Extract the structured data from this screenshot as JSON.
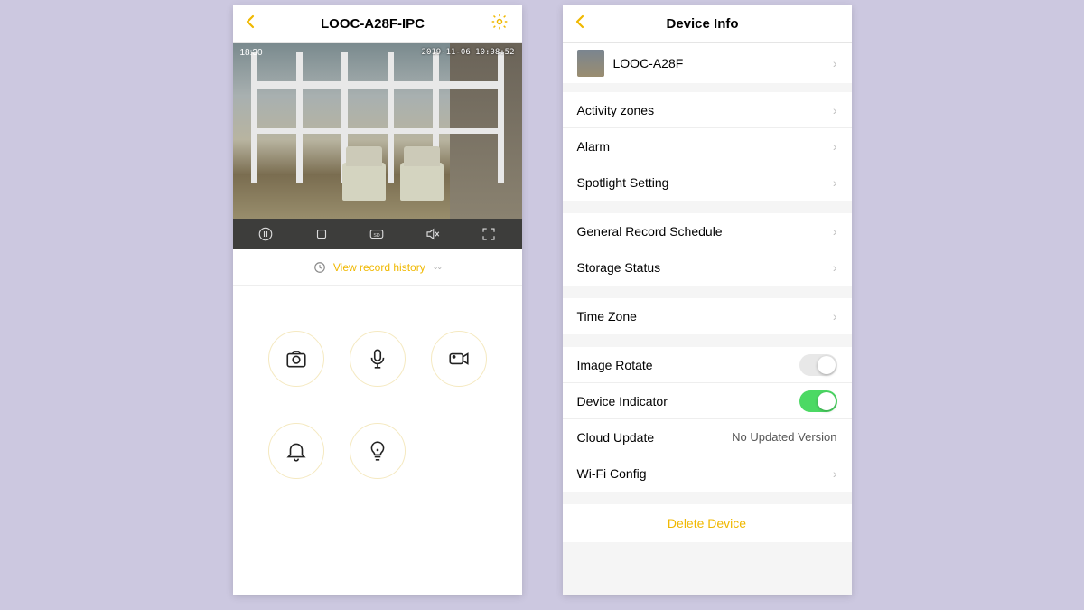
{
  "accent_color": "#f0b800",
  "left": {
    "title": "LOOC-A28F-IPC",
    "overlay_time": "18:30",
    "overlay_timestamp": "2019-11-06 10:08:52",
    "history_label": "View record history",
    "controls": [
      "pause",
      "stop",
      "sd",
      "mute",
      "fullscreen"
    ],
    "actions": [
      "camera",
      "mic",
      "record",
      "bell",
      "light"
    ]
  },
  "right": {
    "title": "Device Info",
    "device_name": "LOOC-A28F",
    "sections": [
      {
        "rows": [
          {
            "label": "Activity zones",
            "type": "nav"
          },
          {
            "label": "Alarm",
            "type": "nav"
          },
          {
            "label": "Spotlight Setting",
            "type": "nav"
          }
        ]
      },
      {
        "rows": [
          {
            "label": "General Record Schedule",
            "type": "nav"
          },
          {
            "label": "Storage Status",
            "type": "nav"
          }
        ]
      },
      {
        "rows": [
          {
            "label": "Time Zone",
            "type": "nav"
          }
        ]
      },
      {
        "rows": [
          {
            "label": "Image Rotate",
            "type": "toggle",
            "on": false
          },
          {
            "label": "Device Indicator",
            "type": "toggle",
            "on": true
          },
          {
            "label": "Cloud Update",
            "type": "value",
            "value": "No Updated Version"
          },
          {
            "label": "Wi-Fi Config",
            "type": "nav"
          }
        ]
      }
    ],
    "delete_label": "Delete Device"
  }
}
